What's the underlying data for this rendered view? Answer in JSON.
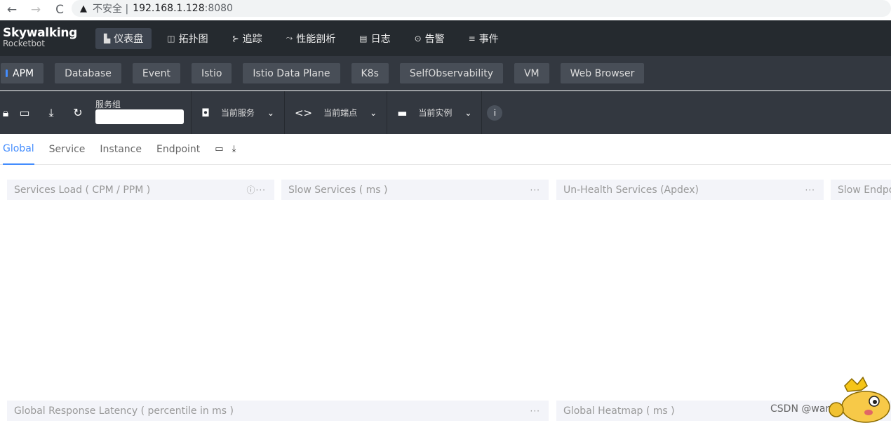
{
  "browser": {
    "back_icon": "←",
    "forward_icon": "→",
    "reload_icon": "C",
    "warning_icon": "▲",
    "insecure_label": "不安全 |",
    "host": "192.168.1.128",
    "port": ":8080"
  },
  "app": {
    "logo_name": "Skywalking",
    "logo_sub": "Rocketbot",
    "nav": [
      {
        "icon": "▙",
        "label": "仪表盘"
      },
      {
        "icon": "◫",
        "label": "拓扑图"
      },
      {
        "icon": "⊱",
        "label": "追踪"
      },
      {
        "icon": "⤳",
        "label": "性能剖析"
      },
      {
        "icon": "▤",
        "label": "日志"
      },
      {
        "icon": "⊙",
        "label": "告警"
      },
      {
        "icon": "≡",
        "label": "事件"
      }
    ],
    "layers": [
      "APM",
      "Database",
      "Event",
      "Istio",
      "Istio Data Plane",
      "K8s",
      "SelfObservability",
      "VM",
      "Web Browser"
    ]
  },
  "toolbar": {
    "group_label": "服务组",
    "group_value": "",
    "service_label": "当前服务",
    "endpoint_label": "当前端点",
    "instance_label": "当前实例",
    "lock_icon": "🔒︎",
    "folder_icon": "▭",
    "download_icon": "⤓",
    "refresh_icon": "↻",
    "chevron": "⌄",
    "service_icon": "◘",
    "endpoint_icon": "<>",
    "instance_icon": "▬",
    "info_icon": "i"
  },
  "dashboard": {
    "tabs": [
      "Global",
      "Service",
      "Instance",
      "Endpoint"
    ],
    "folder_icon": "▭",
    "download_icon": "⤓",
    "widgets_row1": [
      {
        "title": "Services Load ( CPM / PPM )",
        "tools": "ⓘ···"
      },
      {
        "title": "Slow Services ( ms )",
        "tools": "···"
      },
      {
        "title": "Un-Health Services (Apdex)",
        "tools": "···"
      },
      {
        "title": "Slow Endpo",
        "tools": ""
      }
    ],
    "widgets_row2": [
      {
        "title": "Global Response Latency ( percentile in ms )",
        "tools": "···"
      },
      {
        "title": "Global Heatmap ( ms )",
        "tools": ""
      }
    ]
  },
  "watermark": "CSDN @wang_xiansi",
  "colors": {
    "nav_bg": "#252a2f",
    "layer_bg": "#333840",
    "accent": "#448dfe"
  }
}
